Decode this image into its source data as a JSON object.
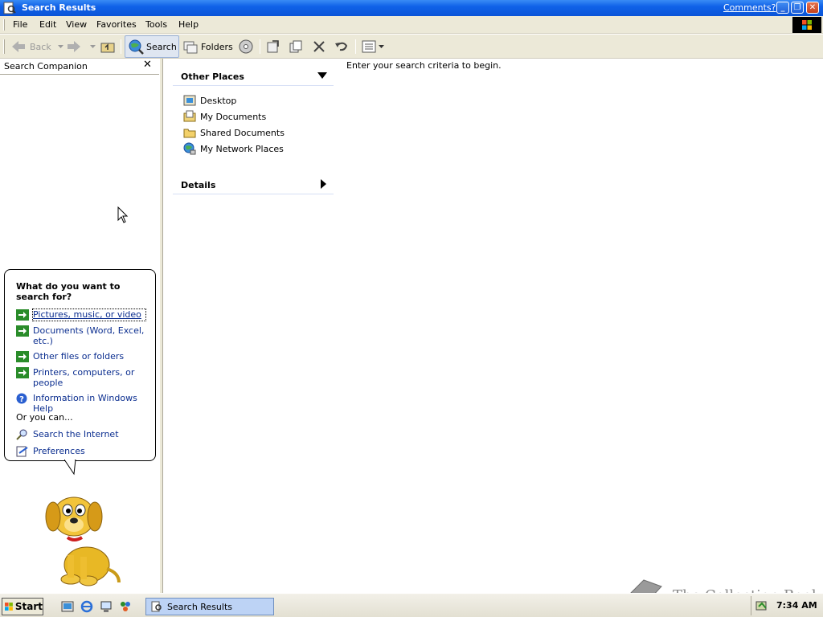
{
  "window": {
    "title": "Search Results",
    "comments_link": "Comments?",
    "minimize": "_",
    "restore": "❐",
    "close": "✕"
  },
  "menu": [
    "File",
    "Edit",
    "View",
    "Favorites",
    "Tools",
    "Help"
  ],
  "toolbar": {
    "back_label": "Back",
    "search_label": "Search",
    "folders_label": "Folders"
  },
  "search_companion": {
    "header": "Search Companion",
    "close_glyph": "✕",
    "question": "What do you want to search for?",
    "options": [
      "Pictures, music, or video",
      "Documents (Word, Excel, etc.)",
      "Other files or folders",
      "Printers, computers, or people",
      "Information in Windows Help"
    ],
    "or_you_can": "Or you can...",
    "extra_options": [
      "Search the Internet",
      "Preferences"
    ]
  },
  "tasks": {
    "other_places_title": "Other Places",
    "places": [
      "Desktop",
      "My Documents",
      "Shared Documents",
      "My Network Places"
    ],
    "details_title": "Details"
  },
  "main": {
    "criteria_text": "Enter your search criteria to begin."
  },
  "watermark": "The Collection Book",
  "taskbar": {
    "start_label": "Start",
    "task_label": "Search Results",
    "clock": "7:34 AM"
  },
  "colors": {
    "titlebar": "#0a54d8",
    "chrome": "#ece9d8",
    "link": "#0a2d8f",
    "arrow_green": "#2a8c2a"
  }
}
